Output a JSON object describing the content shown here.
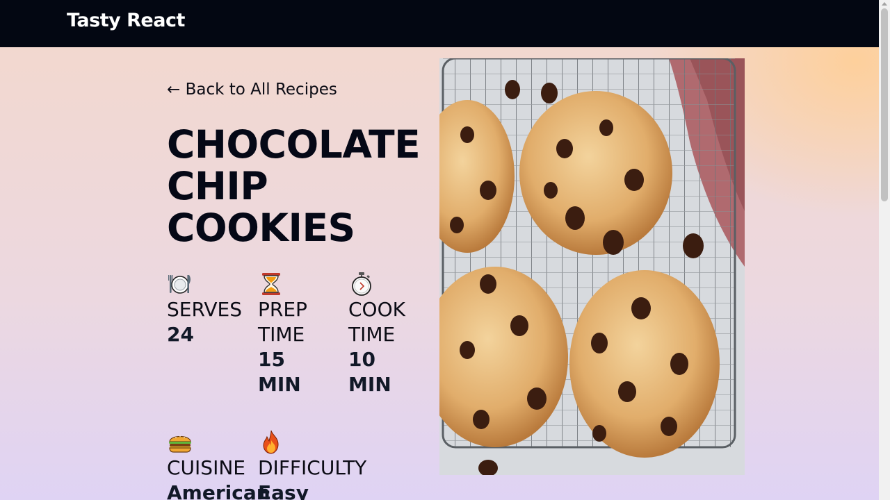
{
  "navbar": {
    "brand": "Tasty React"
  },
  "recipe": {
    "back_link": "← Back to All Recipes",
    "title_lines": [
      "CHOCOLATE",
      "CHIP",
      "COOKIES"
    ],
    "meta": [
      {
        "icon": "fork-plate-knife-icon",
        "label": "SERVES",
        "value": "24"
      },
      {
        "icon": "hourglass-icon",
        "label": "PREP TIME",
        "value": "15 MIN"
      },
      {
        "icon": "stopwatch-icon",
        "label": "COOK TIME",
        "value": "10 MIN"
      },
      {
        "icon": "hamburger-icon",
        "label": "CUISINE",
        "value": "American"
      },
      {
        "icon": "fire-icon",
        "label": "DIFFICULTY",
        "value": "Easy"
      }
    ]
  },
  "colors": {
    "navbar_bg": "#030712",
    "text_dark": "#050816",
    "accent_peach": "#ffcf96",
    "accent_lavender": "#dfd3f4"
  }
}
